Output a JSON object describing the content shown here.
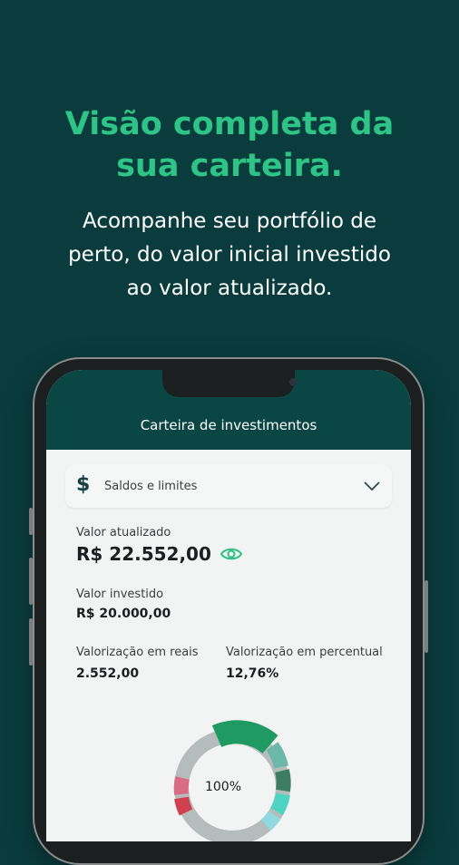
{
  "headline": {
    "line1": "Visão completa da",
    "line2": "sua carteira."
  },
  "subhead": {
    "line1": "Acompanhe seu portfólio de",
    "line2": "perto, do valor inicial investido",
    "line3": "ao valor atualizado."
  },
  "app": {
    "title": "Carteira de investimentos",
    "balances_card": {
      "icon": "dollar-icon",
      "label": "Saldos e limites",
      "chevron": "chevron-down-icon"
    },
    "current_value": {
      "label": "Valor atualizado",
      "value": "R$ 22.552,00",
      "icon": "eye-icon"
    },
    "invested": {
      "label": "Valor investido",
      "value": "R$ 20.000,00"
    },
    "gain_reais": {
      "label": "Valorização em reais",
      "value": "2.552,00"
    },
    "gain_percent": {
      "label": "Valorização em percentual",
      "value": "12,76%"
    },
    "donut": {
      "center_label": "100%"
    }
  },
  "colors": {
    "background": "#0a3c3d",
    "accent_green": "#2ec486",
    "header": "#0a4644",
    "eye_icon": "#2fbf87"
  }
}
